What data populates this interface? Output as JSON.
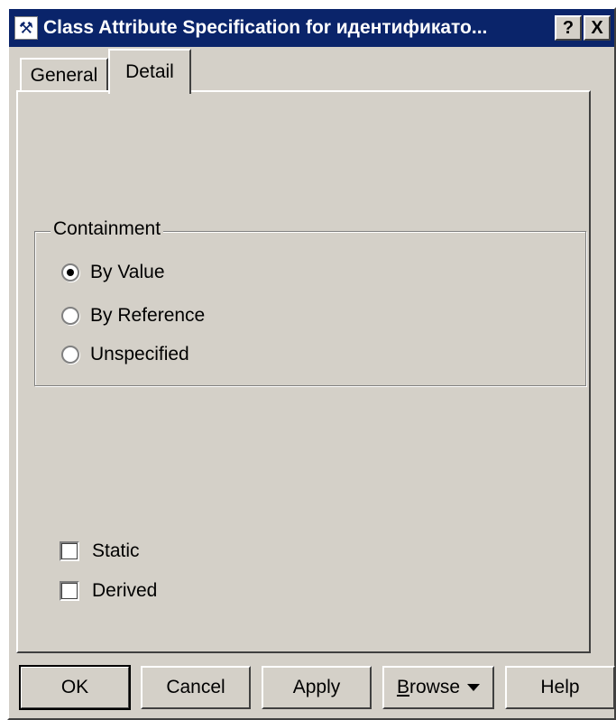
{
  "window": {
    "title": "Class Attribute Specification for идентификато...",
    "help_label": "?",
    "close_label": "X"
  },
  "tabs": [
    {
      "label": "General",
      "active": false
    },
    {
      "label": "Detail",
      "active": true
    }
  ],
  "containment": {
    "label": "Containment",
    "options": [
      {
        "label": "By Value",
        "selected": true
      },
      {
        "label": "By Reference",
        "selected": false
      },
      {
        "label": "Unspecified",
        "selected": false
      }
    ]
  },
  "checkboxes": [
    {
      "label": "Static",
      "checked": false
    },
    {
      "label": "Derived",
      "checked": false
    }
  ],
  "buttons": {
    "ok": "OK",
    "cancel": "Cancel",
    "apply": "Apply",
    "browse_first": "B",
    "browse_rest": "rowse",
    "help": "Help"
  }
}
